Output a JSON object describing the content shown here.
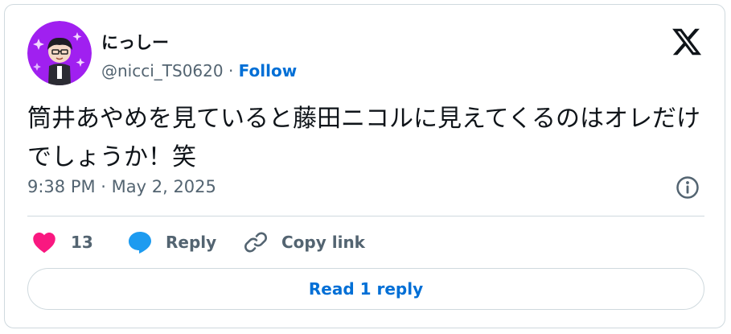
{
  "author": {
    "display_name": "にっしー",
    "handle": "@nicci_TS0620",
    "separator": "·",
    "follow_label": "Follow"
  },
  "tweet": {
    "text": "筒井あやめを見ていると藤田ニコルに見えてくるのはオレだけでしょうか！笑",
    "timestamp": "9:38 PM · May 2, 2025"
  },
  "actions": {
    "like_count": "13",
    "reply_label": "Reply",
    "copy_link_label": "Copy link"
  },
  "read_replies_label": "Read 1 reply",
  "colors": {
    "like": "#f91880",
    "reply": "#1d9bf0",
    "link": "#006fd6",
    "muted": "#536471",
    "avatar_bg": "#a020f0"
  },
  "icons": [
    "x-logo-icon",
    "info-icon",
    "heart-icon",
    "reply-bubble-icon",
    "link-icon"
  ]
}
